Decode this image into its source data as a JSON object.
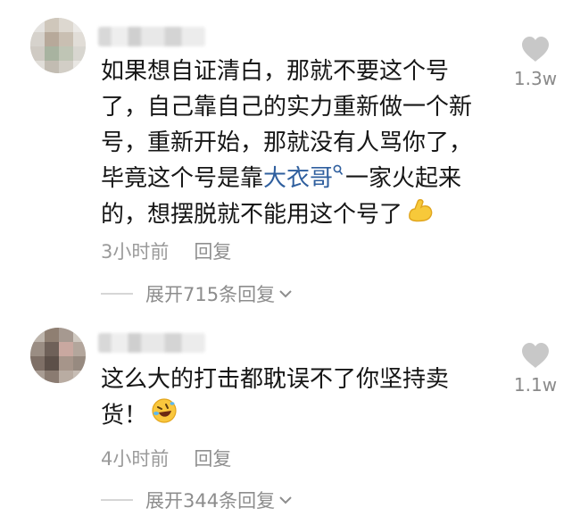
{
  "comments": [
    {
      "text_before": "如果想自证清白，那就不要这个号了，自己靠自己的实力重新做一个新号，重新开始，那就没有人骂你了，毕竟这个号是靠",
      "link": "大衣哥",
      "text_after": "一家火起来的，想摆脱就不能用这个号了",
      "emoji": "flexed-biceps",
      "likes": "1.3w",
      "time": "3小时前",
      "reply_label": "回复",
      "expand_label": "展开715条回复"
    },
    {
      "text_before": "这么大的打击都耽误不了你坚持卖货！",
      "link": "",
      "text_after": "",
      "emoji": "rolling-laughing",
      "likes": "1.1w",
      "time": "4小时前",
      "reply_label": "回复",
      "expand_label": "展开344条回复"
    }
  ],
  "colors": {
    "text": "#161616",
    "link": "#2f5f9e",
    "muted": "#9a9a9a",
    "heart": "#c8c8c8"
  },
  "icons": [
    "heart-icon",
    "search-icon",
    "chevron-down-icon",
    "flexed-biceps-emoji",
    "rolling-laughing-emoji"
  ]
}
